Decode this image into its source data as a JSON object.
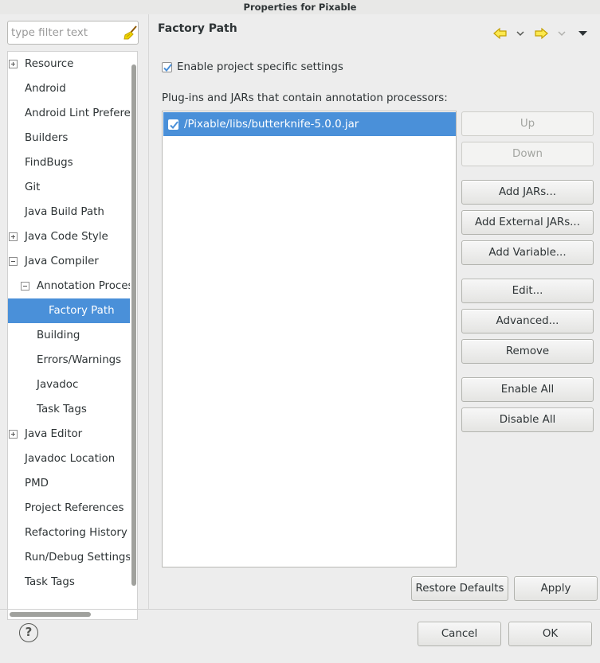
{
  "window": {
    "title": "Properties for Pixable"
  },
  "filter": {
    "placeholder": "type filter text"
  },
  "tree": {
    "items": [
      {
        "label": "Resource"
      },
      {
        "label": "Android"
      },
      {
        "label": "Android Lint Preferences"
      },
      {
        "label": "Builders"
      },
      {
        "label": "FindBugs"
      },
      {
        "label": "Git"
      },
      {
        "label": "Java Build Path"
      },
      {
        "label": "Java Code Style"
      },
      {
        "label": "Java Compiler"
      },
      {
        "label": "Annotation Processing"
      },
      {
        "label": "Factory Path"
      },
      {
        "label": "Building"
      },
      {
        "label": "Errors/Warnings"
      },
      {
        "label": "Javadoc"
      },
      {
        "label": "Task Tags"
      },
      {
        "label": "Java Editor"
      },
      {
        "label": "Javadoc Location"
      },
      {
        "label": "PMD"
      },
      {
        "label": "Project References"
      },
      {
        "label": "Refactoring History"
      },
      {
        "label": "Run/Debug Settings"
      },
      {
        "label": "Task Tags"
      }
    ]
  },
  "page": {
    "title": "Factory Path",
    "enable_label": "Enable project specific settings",
    "enable_checked": true,
    "list_label": "Plug-ins and JARs that contain annotation processors:",
    "jars": [
      {
        "path": "/Pixable/libs/butterknife-5.0.0.jar",
        "checked": true
      }
    ]
  },
  "buttons": {
    "up": "Up",
    "down": "Down",
    "add_jars": "Add JARs...",
    "add_external_jars": "Add External JARs...",
    "add_variable": "Add Variable...",
    "edit": "Edit...",
    "advanced": "Advanced...",
    "remove": "Remove",
    "enable_all": "Enable All",
    "disable_all": "Disable All",
    "restore_defaults": "Restore Defaults",
    "apply": "Apply",
    "cancel": "Cancel",
    "ok": "OK",
    "help": "?"
  },
  "colors": {
    "selection": "#4a90d9",
    "nav_arrow": "#c4a000"
  },
  "icons": {
    "filter_clear": "broom-icon",
    "back": "arrow-left-icon",
    "forward": "arrow-right-icon",
    "menu": "triangle-down-icon"
  }
}
